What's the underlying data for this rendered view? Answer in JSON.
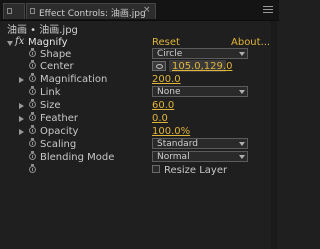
{
  "tabs": {
    "main_label": "Effect Controls: 油画.jpg",
    "close_glyph": "×"
  },
  "breadcrumb": "油画 • 油画.jpg",
  "effect": {
    "fx_glyph": "fx",
    "name": "Magnify",
    "reset_label": "Reset",
    "about_label": "About..."
  },
  "properties": [
    {
      "label": "Shape",
      "type": "dropdown",
      "value": "Circle"
    },
    {
      "label": "Center",
      "type": "point",
      "value": "105.0,129.0"
    },
    {
      "label": "Magnification",
      "type": "number",
      "value": "200.0"
    },
    {
      "label": "Link",
      "type": "dropdown",
      "value": "None"
    },
    {
      "label": "Size",
      "type": "number",
      "value": "60.0"
    },
    {
      "label": "Feather",
      "type": "number",
      "value": "0.0"
    },
    {
      "label": "Opacity",
      "type": "number",
      "value": "100.0%"
    },
    {
      "label": "Scaling",
      "type": "dropdown",
      "value": "Standard"
    },
    {
      "label": "Blending Mode",
      "type": "dropdown",
      "value": "Normal"
    },
    {
      "label": "",
      "type": "checkbox",
      "value": "Resize Layer"
    }
  ],
  "colors": {
    "panel_bg": "#1f1f1f",
    "value_orange": "#e0b53a",
    "text": "#c8c8c8"
  }
}
